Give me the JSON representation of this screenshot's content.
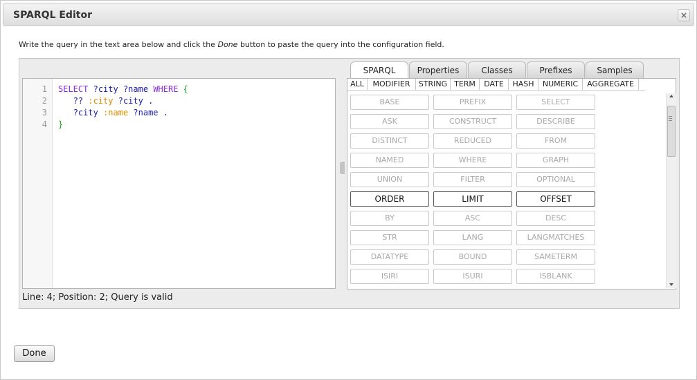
{
  "dialog": {
    "title": "SPARQL Editor",
    "close_label": "×",
    "instructions_before": "Write the query in the text area below and click the ",
    "instructions_emphasis": "Done",
    "instructions_after": " button to paste the query into the configuration field.",
    "done_label": "Done"
  },
  "editor": {
    "line_numbers": [
      "1",
      "2",
      "3",
      "4"
    ],
    "lines": [
      [
        {
          "t": "SELECT",
          "c": "kw"
        },
        {
          "t": " "
        },
        {
          "t": "?city",
          "c": "var"
        },
        {
          "t": " "
        },
        {
          "t": "?name",
          "c": "var"
        },
        {
          "t": " "
        },
        {
          "t": "WHERE",
          "c": "kw"
        },
        {
          "t": " "
        },
        {
          "t": "{",
          "c": "br"
        }
      ],
      [
        {
          "t": "   "
        },
        {
          "t": "??",
          "c": "ph"
        },
        {
          "t": " "
        },
        {
          "t": ":city",
          "c": "pn"
        },
        {
          "t": " "
        },
        {
          "t": "?city",
          "c": "var"
        },
        {
          "t": " "
        },
        {
          "t": ".",
          "c": "dot"
        }
      ],
      [
        {
          "t": "   "
        },
        {
          "t": "?city",
          "c": "var"
        },
        {
          "t": " "
        },
        {
          "t": ":name",
          "c": "pn"
        },
        {
          "t": " "
        },
        {
          "t": "?name",
          "c": "var"
        },
        {
          "t": " "
        },
        {
          "t": ".",
          "c": "dot"
        }
      ],
      [
        {
          "t": "}",
          "c": "br"
        }
      ]
    ]
  },
  "tabs": [
    "SPARQL",
    "Properties",
    "Classes",
    "Prefixes",
    "Samples"
  ],
  "active_tab": "SPARQL",
  "filters": [
    "ALL",
    "MODIFIER",
    "STRING",
    "TERM",
    "DATE",
    "HASH",
    "NUMERIC",
    "AGGREGATE"
  ],
  "keywords": [
    {
      "label": "BASE",
      "enabled": false
    },
    {
      "label": "PREFIX",
      "enabled": false
    },
    {
      "label": "SELECT",
      "enabled": false
    },
    {
      "label": "ASK",
      "enabled": false
    },
    {
      "label": "CONSTRUCT",
      "enabled": false
    },
    {
      "label": "DESCRIBE",
      "enabled": false
    },
    {
      "label": "DISTINCT",
      "enabled": false
    },
    {
      "label": "REDUCED",
      "enabled": false
    },
    {
      "label": "FROM",
      "enabled": false
    },
    {
      "label": "NAMED",
      "enabled": false
    },
    {
      "label": "WHERE",
      "enabled": false
    },
    {
      "label": "GRAPH",
      "enabled": false
    },
    {
      "label": "UNION",
      "enabled": false
    },
    {
      "label": "FILTER",
      "enabled": false
    },
    {
      "label": "OPTIONAL",
      "enabled": false
    },
    {
      "label": "ORDER",
      "enabled": true
    },
    {
      "label": "LIMIT",
      "enabled": true
    },
    {
      "label": "OFFSET",
      "enabled": true
    },
    {
      "label": "BY",
      "enabled": false
    },
    {
      "label": "ASC",
      "enabled": false
    },
    {
      "label": "DESC",
      "enabled": false
    },
    {
      "label": "STR",
      "enabled": false
    },
    {
      "label": "LANG",
      "enabled": false
    },
    {
      "label": "LANGMATCHES",
      "enabled": false
    },
    {
      "label": "DATATYPE",
      "enabled": false
    },
    {
      "label": "BOUND",
      "enabled": false
    },
    {
      "label": "SAMETERM",
      "enabled": false
    },
    {
      "label": "ISIRI",
      "enabled": false
    },
    {
      "label": "ISURI",
      "enabled": false
    },
    {
      "label": "ISBLANK",
      "enabled": false
    }
  ],
  "status": "Line: 4; Position: 2; Query is valid",
  "colors": {
    "keyword": "#8a2be2",
    "variable": "#1a1aa6",
    "prefixed_name": "#e08a00",
    "brace": "#1aaa1a"
  }
}
